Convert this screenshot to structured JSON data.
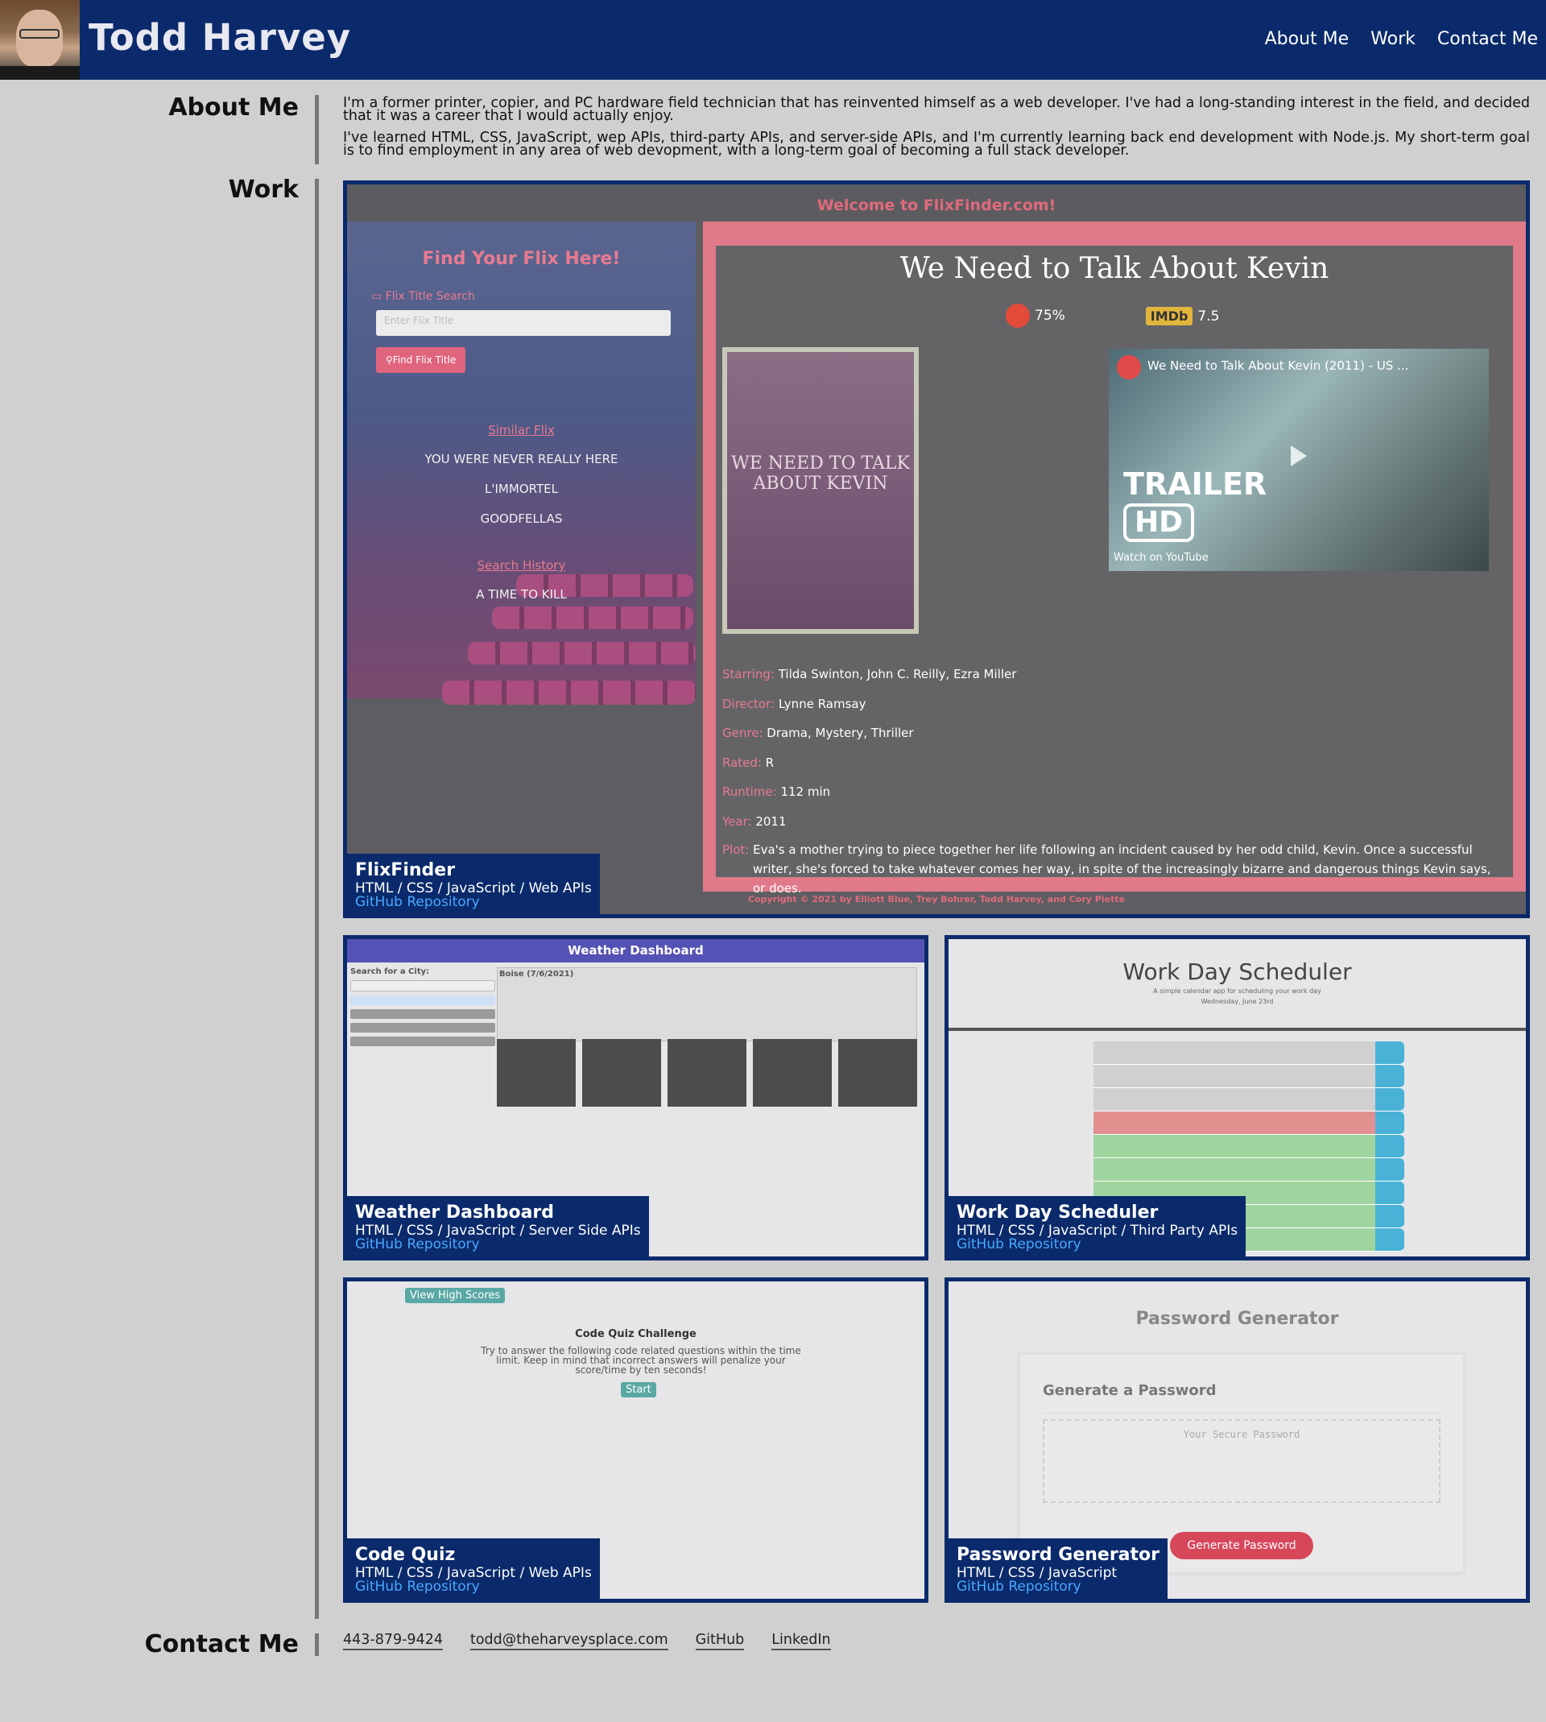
{
  "header": {
    "name": "Todd Harvey",
    "nav": [
      "About Me",
      "Work",
      "Contact Me"
    ]
  },
  "about": {
    "heading": "About Me",
    "paragraphs": [
      "I'm a former printer, copier, and PC hardware field technician that has reinvented himself as a web developer. I've had a long-standing interest in the field, and decided that it was a career that I would actually enjoy.",
      "I've learned HTML, CSS, JavaScript, wep APIs, third-party APIs, and server-side APIs, and I'm currently learning back end development with Node.js. My short-term goal is to find employment in any area of web devopment, with a long-term goal of becoming a full stack developer."
    ]
  },
  "work": {
    "heading": "Work",
    "projects": [
      {
        "title": "FlixFinder",
        "tech": "HTML / CSS / JavaScript / Web APIs",
        "link": "GitHub Repository"
      },
      {
        "title": "Weather Dashboard",
        "tech": "HTML / CSS / JavaScript / Server Side APIs",
        "link": "GitHub Repository"
      },
      {
        "title": "Work Day Scheduler",
        "tech": "HTML / CSS / JavaScript / Third Party APIs",
        "link": "GitHub Repository"
      },
      {
        "title": "Code Quiz",
        "tech": "HTML / CSS / JavaScript / Web APIs",
        "link": "GitHub Repository"
      },
      {
        "title": "Password Generator",
        "tech": "HTML / CSS / JavaScript",
        "link": "GitHub Repository"
      }
    ]
  },
  "flixfinder_preview": {
    "welcome": "Welcome to FlixFinder.com!",
    "find_heading": "Find Your Flix Here!",
    "search_label": "Flix Title Search",
    "search_placeholder": "Enter Flix Title",
    "search_button": "Find Flix Title",
    "similar_heading": "Similar Flix",
    "similar": [
      "YOU WERE NEVER REALLY HERE",
      "L'IMMORTEL",
      "GOODFELLAS"
    ],
    "history_heading": "Search History",
    "history": [
      "A TIME TO KILL"
    ],
    "movie_title": "We Need to Talk About Kevin",
    "rt_score": "75%",
    "imdb_label": "IMDb",
    "imdb_score": "7.5",
    "poster_text": "WE NEED TO TALK ABOUT KEVIN",
    "video_title": "We Need to Talk About Kevin (2011) - US ...",
    "trailer": "TRAILER",
    "hd": "HD",
    "watch_on": "Watch on YouTube",
    "details": [
      {
        "key": "Starring:",
        "value": "Tilda Swinton, John C. Reilly, Ezra Miller"
      },
      {
        "key": "Director:",
        "value": "Lynne Ramsay"
      },
      {
        "key": "Genre:",
        "value": "Drama, Mystery, Thriller"
      },
      {
        "key": "Rated:",
        "value": "R"
      },
      {
        "key": "Runtime:",
        "value": "112 min"
      },
      {
        "key": "Year:",
        "value": "2011"
      }
    ],
    "plot_key": "Plot:",
    "plot": "Eva's a mother trying to piece together her life following an incident caused by her odd child, Kevin. Once a successful writer, she's forced to take whatever comes her way, in spite of the increasingly bizarre and dangerous things Kevin says, or does.",
    "copyright": "Copyright © 2021 by Elliott Blue, Trey Bohrer, Todd Harvey, and Cory Piette"
  },
  "weather_preview": {
    "title": "Weather Dashboard",
    "search_label": "Search for a City:",
    "city": "Boise (7/6/2021)"
  },
  "scheduler_preview": {
    "title": "Work Day Scheduler",
    "subtitle": "A simple calendar app for scheduling your work day",
    "date": "Wednesday, June 23rd"
  },
  "quiz_preview": {
    "high_scores": "View High Scores",
    "title": "Code Quiz Challenge",
    "description": "Try to answer the following code related questions within the time limit. Keep in mind that incorrect answers will penalize your score/time by ten seconds!",
    "start": "Start"
  },
  "password_preview": {
    "title": "Password Generator",
    "card_heading": "Generate a Password",
    "placeholder": "Your Secure Password",
    "button": "Generate Password"
  },
  "contact": {
    "heading": "Contact Me",
    "links": [
      "443-879-9424",
      "todd@theharveysplace.com",
      "GitHub",
      "LinkedIn"
    ]
  },
  "colors": {
    "header_bg": "#0a2a6b",
    "page_bg": "#d0d0d0",
    "link": "#4aa8ff",
    "flix_accent": "#e07a8a"
  }
}
